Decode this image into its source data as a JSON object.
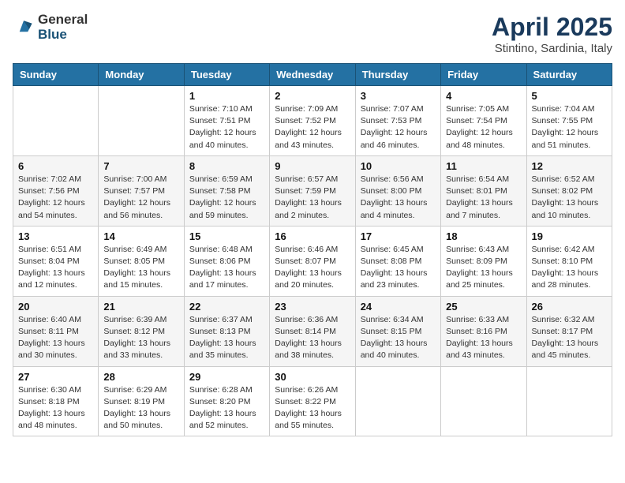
{
  "header": {
    "logo_general": "General",
    "logo_blue": "Blue",
    "month_title": "April 2025",
    "location": "Stintino, Sardinia, Italy"
  },
  "columns": [
    "Sunday",
    "Monday",
    "Tuesday",
    "Wednesday",
    "Thursday",
    "Friday",
    "Saturday"
  ],
  "weeks": [
    [
      {
        "day": "",
        "info": ""
      },
      {
        "day": "",
        "info": ""
      },
      {
        "day": "1",
        "info": "Sunrise: 7:10 AM\nSunset: 7:51 PM\nDaylight: 12 hours\nand 40 minutes."
      },
      {
        "day": "2",
        "info": "Sunrise: 7:09 AM\nSunset: 7:52 PM\nDaylight: 12 hours\nand 43 minutes."
      },
      {
        "day": "3",
        "info": "Sunrise: 7:07 AM\nSunset: 7:53 PM\nDaylight: 12 hours\nand 46 minutes."
      },
      {
        "day": "4",
        "info": "Sunrise: 7:05 AM\nSunset: 7:54 PM\nDaylight: 12 hours\nand 48 minutes."
      },
      {
        "day": "5",
        "info": "Sunrise: 7:04 AM\nSunset: 7:55 PM\nDaylight: 12 hours\nand 51 minutes."
      }
    ],
    [
      {
        "day": "6",
        "info": "Sunrise: 7:02 AM\nSunset: 7:56 PM\nDaylight: 12 hours\nand 54 minutes."
      },
      {
        "day": "7",
        "info": "Sunrise: 7:00 AM\nSunset: 7:57 PM\nDaylight: 12 hours\nand 56 minutes."
      },
      {
        "day": "8",
        "info": "Sunrise: 6:59 AM\nSunset: 7:58 PM\nDaylight: 12 hours\nand 59 minutes."
      },
      {
        "day": "9",
        "info": "Sunrise: 6:57 AM\nSunset: 7:59 PM\nDaylight: 13 hours\nand 2 minutes."
      },
      {
        "day": "10",
        "info": "Sunrise: 6:56 AM\nSunset: 8:00 PM\nDaylight: 13 hours\nand 4 minutes."
      },
      {
        "day": "11",
        "info": "Sunrise: 6:54 AM\nSunset: 8:01 PM\nDaylight: 13 hours\nand 7 minutes."
      },
      {
        "day": "12",
        "info": "Sunrise: 6:52 AM\nSunset: 8:02 PM\nDaylight: 13 hours\nand 10 minutes."
      }
    ],
    [
      {
        "day": "13",
        "info": "Sunrise: 6:51 AM\nSunset: 8:04 PM\nDaylight: 13 hours\nand 12 minutes."
      },
      {
        "day": "14",
        "info": "Sunrise: 6:49 AM\nSunset: 8:05 PM\nDaylight: 13 hours\nand 15 minutes."
      },
      {
        "day": "15",
        "info": "Sunrise: 6:48 AM\nSunset: 8:06 PM\nDaylight: 13 hours\nand 17 minutes."
      },
      {
        "day": "16",
        "info": "Sunrise: 6:46 AM\nSunset: 8:07 PM\nDaylight: 13 hours\nand 20 minutes."
      },
      {
        "day": "17",
        "info": "Sunrise: 6:45 AM\nSunset: 8:08 PM\nDaylight: 13 hours\nand 23 minutes."
      },
      {
        "day": "18",
        "info": "Sunrise: 6:43 AM\nSunset: 8:09 PM\nDaylight: 13 hours\nand 25 minutes."
      },
      {
        "day": "19",
        "info": "Sunrise: 6:42 AM\nSunset: 8:10 PM\nDaylight: 13 hours\nand 28 minutes."
      }
    ],
    [
      {
        "day": "20",
        "info": "Sunrise: 6:40 AM\nSunset: 8:11 PM\nDaylight: 13 hours\nand 30 minutes."
      },
      {
        "day": "21",
        "info": "Sunrise: 6:39 AM\nSunset: 8:12 PM\nDaylight: 13 hours\nand 33 minutes."
      },
      {
        "day": "22",
        "info": "Sunrise: 6:37 AM\nSunset: 8:13 PM\nDaylight: 13 hours\nand 35 minutes."
      },
      {
        "day": "23",
        "info": "Sunrise: 6:36 AM\nSunset: 8:14 PM\nDaylight: 13 hours\nand 38 minutes."
      },
      {
        "day": "24",
        "info": "Sunrise: 6:34 AM\nSunset: 8:15 PM\nDaylight: 13 hours\nand 40 minutes."
      },
      {
        "day": "25",
        "info": "Sunrise: 6:33 AM\nSunset: 8:16 PM\nDaylight: 13 hours\nand 43 minutes."
      },
      {
        "day": "26",
        "info": "Sunrise: 6:32 AM\nSunset: 8:17 PM\nDaylight: 13 hours\nand 45 minutes."
      }
    ],
    [
      {
        "day": "27",
        "info": "Sunrise: 6:30 AM\nSunset: 8:18 PM\nDaylight: 13 hours\nand 48 minutes."
      },
      {
        "day": "28",
        "info": "Sunrise: 6:29 AM\nSunset: 8:19 PM\nDaylight: 13 hours\nand 50 minutes."
      },
      {
        "day": "29",
        "info": "Sunrise: 6:28 AM\nSunset: 8:20 PM\nDaylight: 13 hours\nand 52 minutes."
      },
      {
        "day": "30",
        "info": "Sunrise: 6:26 AM\nSunset: 8:22 PM\nDaylight: 13 hours\nand 55 minutes."
      },
      {
        "day": "",
        "info": ""
      },
      {
        "day": "",
        "info": ""
      },
      {
        "day": "",
        "info": ""
      }
    ]
  ]
}
